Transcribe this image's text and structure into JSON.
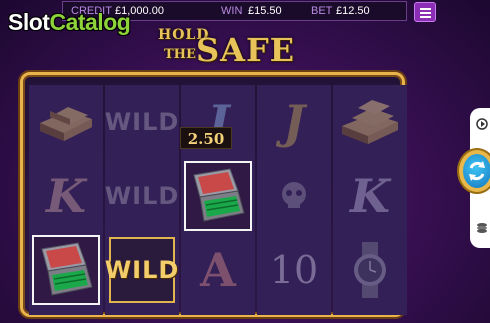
{
  "brand": {
    "slot": "Slot",
    "catalog": "Catalog"
  },
  "header": {
    "credit_label": "CREDIT",
    "credit_value": "£1,000.00",
    "win_label": "WIN",
    "win_value": "£15.50",
    "bet_label": "BET",
    "bet_value": "£12.50"
  },
  "logo": {
    "line1": "HOLD",
    "line2": "THE",
    "line3": "SAFE"
  },
  "reels": {
    "reel1": [
      "gold-bars",
      "K",
      "cash-case"
    ],
    "reel2": [
      "WILD",
      "WILD",
      "WILD"
    ],
    "reel3": [
      "J",
      "cash-case",
      "A"
    ],
    "reel4": [
      "J",
      "skull",
      "10"
    ],
    "reel5": [
      "gold-bars",
      "K",
      "watch"
    ]
  },
  "symbol_text": {
    "wild": "WILD",
    "k": "K",
    "j": "J",
    "a": "A",
    "ten": "10"
  },
  "prize_value": "2.50",
  "colors": {
    "accent": "#e9b44c",
    "spin": "#1777bd",
    "menu": "#8c2db5"
  }
}
